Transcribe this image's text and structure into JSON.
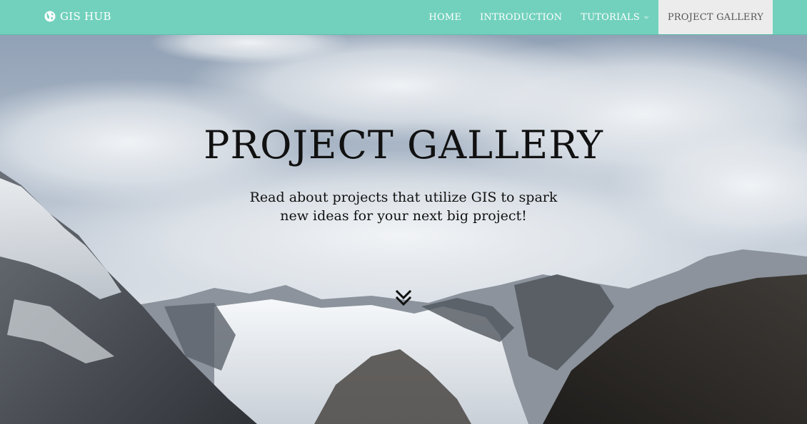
{
  "navbar": {
    "brand": "GIS HUB",
    "brand_icon": "globe-icon",
    "items": [
      {
        "label": "HOME",
        "active": false,
        "dropdown": false
      },
      {
        "label": "INTRODUCTION",
        "active": false,
        "dropdown": false
      },
      {
        "label": "TUTORIALS",
        "active": false,
        "dropdown": true
      },
      {
        "label": "PROJECT GALLERY",
        "active": true,
        "dropdown": false
      }
    ]
  },
  "hero": {
    "title": "PROJECT GALLERY",
    "subtitle_line1": "Read about projects that utilize GIS to spark",
    "subtitle_line2": "new ideas for your next big project!",
    "scroll_icon": "double-chevron-down-icon"
  },
  "colors": {
    "navbar_bg": "#72d1bd",
    "active_nav_bg": "#ececec",
    "text_dark": "#111111"
  }
}
